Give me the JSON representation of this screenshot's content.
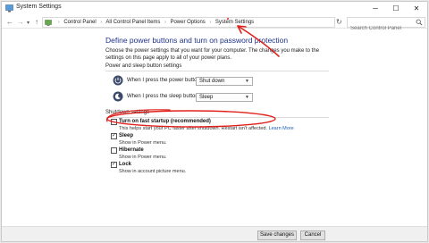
{
  "window": {
    "title": "System Settings",
    "minimize_glyph": "─",
    "maximize_glyph": "☐",
    "close_glyph": "✕"
  },
  "nav": {
    "back": "←",
    "forward": "→",
    "recent": "▾",
    "up": "↑"
  },
  "address": {
    "crumbs": [
      "Control Panel",
      "All Control Panel Items",
      "Power Options",
      "System Settings"
    ],
    "separator": "›",
    "dropdown": "▾",
    "refresh": "↻"
  },
  "search": {
    "placeholder": "Search Control Panel"
  },
  "main": {
    "heading": "Define power buttons and turn on password protection",
    "description": "Choose the power settings that you want for your computer. The changes you make to the settings on this page apply to all of your power plans.",
    "power_section": {
      "label": "Power and sleep button settings",
      "rows": [
        {
          "label": "When I press the power button:",
          "value": "Shut down"
        },
        {
          "label": "When I press the sleep button:",
          "value": "Sleep"
        }
      ]
    },
    "shutdown_section": {
      "label": "Shutdown settings",
      "options": [
        {
          "label": "Turn on fast startup (recommended)",
          "checked": false,
          "description": "This helps start your PC faster after shutdown. Restart isn't affected.",
          "link": "Learn More"
        },
        {
          "label": "Sleep",
          "checked": true,
          "description": "Show in Power menu."
        },
        {
          "label": "Hibernate",
          "checked": false,
          "description": "Show in Power menu."
        },
        {
          "label": "Lock",
          "checked": true,
          "description": "Show in account picture menu."
        }
      ]
    }
  },
  "footer": {
    "save_label": "Save changes",
    "cancel_label": "Cancel"
  },
  "annotation": {
    "color": "#e0201b"
  },
  "icons": [
    "control-panel-icon",
    "search-icon",
    "power-button-icon",
    "sleep-button-icon",
    "checkmark-icon"
  ]
}
